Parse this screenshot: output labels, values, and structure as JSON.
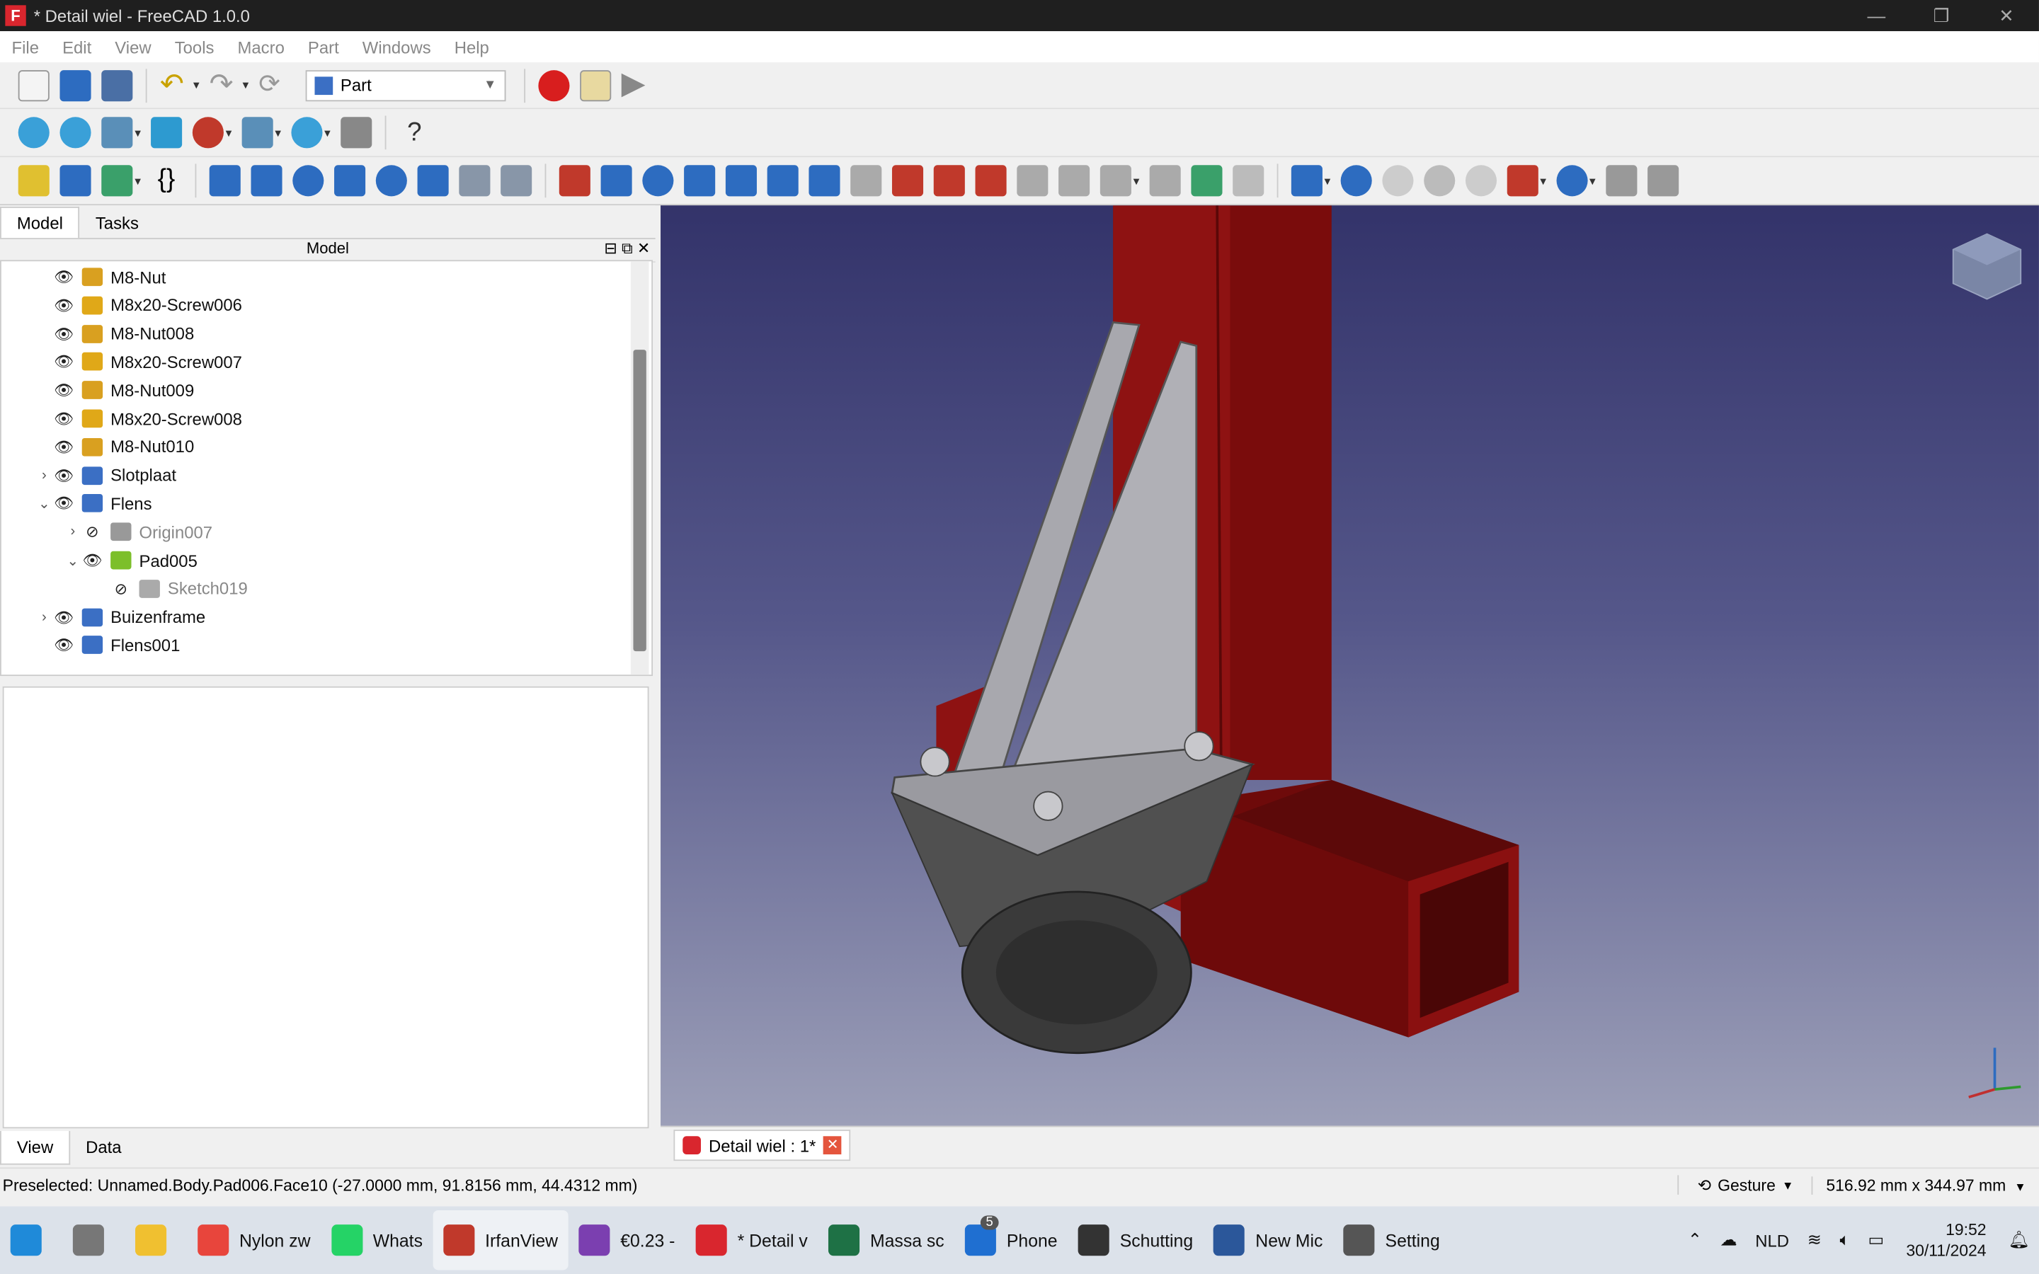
{
  "window": {
    "title": "* Detail wiel - FreeCAD 1.0.0",
    "min": "—",
    "max": "❐",
    "close": "✕"
  },
  "menu": [
    "File",
    "Edit",
    "View",
    "Tools",
    "Macro",
    "Part",
    "Windows",
    "Help"
  ],
  "workbench": {
    "label": "Part"
  },
  "panel": {
    "tabs": [
      "Model",
      "Tasks"
    ],
    "header": "Model",
    "tree": [
      {
        "label": "M8-Nut",
        "indent": 0,
        "icon": "nut-icon",
        "expander": "",
        "visible": true
      },
      {
        "label": "M8x20-Screw006",
        "indent": 0,
        "icon": "screw-icon",
        "expander": "",
        "visible": true
      },
      {
        "label": "M8-Nut008",
        "indent": 0,
        "icon": "nut-icon",
        "expander": "",
        "visible": true
      },
      {
        "label": "M8x20-Screw007",
        "indent": 0,
        "icon": "screw-icon",
        "expander": "",
        "visible": true
      },
      {
        "label": "M8-Nut009",
        "indent": 0,
        "icon": "nut-icon",
        "expander": "",
        "visible": true
      },
      {
        "label": "M8x20-Screw008",
        "indent": 0,
        "icon": "screw-icon",
        "expander": "",
        "visible": true
      },
      {
        "label": "M8-Nut010",
        "indent": 0,
        "icon": "nut-icon",
        "expander": "",
        "visible": true
      },
      {
        "label": "Slotplaat",
        "indent": 0,
        "icon": "body-icon",
        "expander": "›",
        "visible": true
      },
      {
        "label": "Flens",
        "indent": 0,
        "icon": "body-icon",
        "expander": "⌄",
        "visible": true
      },
      {
        "label": "Origin007",
        "indent": 1,
        "icon": "origin-icon",
        "expander": "›",
        "visible": false
      },
      {
        "label": "Pad005",
        "indent": 1,
        "icon": "pad-icon",
        "expander": "⌄",
        "visible": true
      },
      {
        "label": "Sketch019",
        "indent": 2,
        "icon": "sketch-icon",
        "expander": "",
        "visible": false
      },
      {
        "label": "Buizenframe",
        "indent": 0,
        "icon": "body-icon",
        "expander": "›",
        "visible": true
      },
      {
        "label": "Flens001",
        "indent": 0,
        "icon": "link-icon",
        "expander": "",
        "visible": true
      }
    ],
    "bottom_tabs": [
      "View",
      "Data"
    ]
  },
  "document_tab": {
    "label": "Detail wiel : 1*"
  },
  "status": {
    "preselected": "Preselected: Unnamed.Body.Pad006.Face10 (-27.0000 mm, 91.8156 mm, 44.4312 mm)",
    "navigation": "Gesture",
    "dimensions": "516.92 mm x 344.97 mm"
  },
  "taskbar": {
    "apps": [
      {
        "label": "Nylon zw",
        "icon": "chrome-icon",
        "color": "#e8453c"
      },
      {
        "label": "Whats",
        "icon": "whatsapp-icon",
        "color": "#25d366"
      },
      {
        "label": "IrfanView",
        "icon": "irfanview-icon",
        "color": "#c0392b"
      },
      {
        "label": "€0.23 -",
        "icon": "onenote-icon",
        "color": "#7b3fb0"
      },
      {
        "label": "* Detail v",
        "icon": "freecad-icon",
        "color": "#d9262e"
      },
      {
        "label": "Massa sc",
        "icon": "excel-icon",
        "color": "#1e7145"
      },
      {
        "label": "Phone",
        "icon": "phone-icon",
        "color": "#1f6fd1"
      },
      {
        "label": "Schutting",
        "icon": "inkscape-icon",
        "color": "#333333"
      },
      {
        "label": "New Mic",
        "icon": "word-icon",
        "color": "#2b579a"
      },
      {
        "label": "Setting",
        "icon": "settings-icon",
        "color": "#555555"
      }
    ],
    "phone_badge": "5",
    "lang": "NLD",
    "time": "19:52",
    "date": "30/11/2024"
  },
  "colors": {
    "frame_red": "#8a0f0f",
    "plate_grey": "#a9a9ad",
    "wheel": "#3c3c3c",
    "accent": "#2d6cc0"
  }
}
